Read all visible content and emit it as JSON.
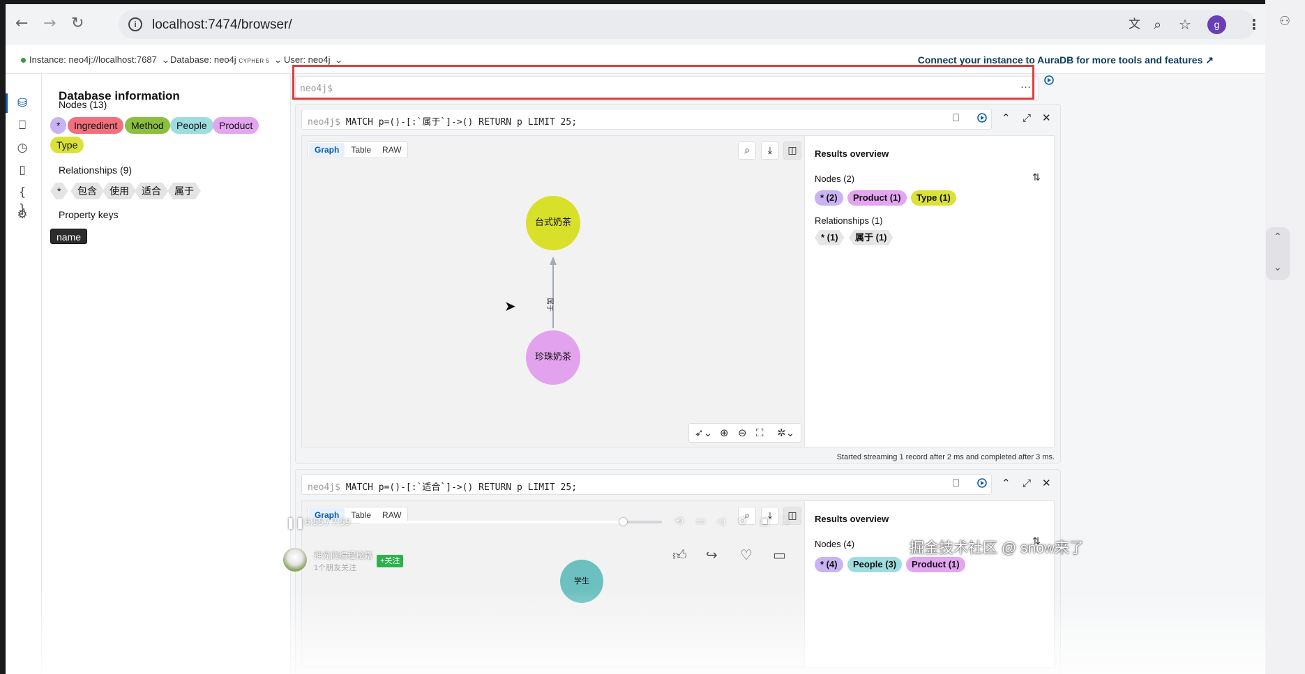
{
  "browser": {
    "url": "localhost:7474/browser/",
    "profile_initial": "g"
  },
  "header": {
    "instance": "Instance: neo4j://localhost:7687",
    "database_prefix": "Database: neo4j",
    "database_badge": "CYPHER 5",
    "user": "User: neo4j",
    "aura_link": "Connect your instance to AuraDB for more tools and features"
  },
  "db_info": {
    "title": "Database information",
    "nodes_title": "Nodes (13)",
    "node_labels": [
      {
        "label": "*",
        "color": "#c9b3f3"
      },
      {
        "label": "Ingredient",
        "color": "#f1707e"
      },
      {
        "label": "Method",
        "color": "#8dbf3e"
      },
      {
        "label": "People",
        "color": "#9ddde0"
      },
      {
        "label": "Product",
        "color": "#e3a5f0"
      },
      {
        "label": "Type",
        "color": "#dae23a"
      }
    ],
    "rels_title": "Relationships (9)",
    "rel_types": [
      "*",
      "包含",
      "使用",
      "适合",
      "属于"
    ],
    "props_title": "Property keys",
    "prop_keys": [
      "name"
    ]
  },
  "editor": {
    "prompt": "neo4j$",
    "more": "···"
  },
  "frames": [
    {
      "prompt": "neo4j$",
      "query": "MATCH p=()-[:`属于`]->() RETURN p LIMIT 25;",
      "tabs": [
        "Graph",
        "Table",
        "RAW"
      ],
      "nodes": [
        {
          "caption": "台式奶茶",
          "color": "#d9e02a"
        },
        {
          "caption": "珍珠奶茶",
          "color": "#e3a2ee"
        }
      ],
      "edge_label": "属于",
      "overview": {
        "title": "Results overview",
        "nodes_title": "Nodes (2)",
        "node_pills": [
          {
            "label": "* (2)",
            "color": "#c9b3f3"
          },
          {
            "label": "Product (1)",
            "color": "#e3a5f0"
          },
          {
            "label": "Type (1)",
            "color": "#dae23a"
          }
        ],
        "rels_title": "Relationships (1)",
        "rel_pills": [
          "* (1)",
          "属于 (1)"
        ]
      },
      "status": "Started streaming 1 record after 2 ms and completed after 3 ms."
    },
    {
      "prompt": "neo4j$",
      "query": "MATCH p=()-[:`适合`]->() RETURN p LIMIT 25;",
      "tabs": [
        "Graph",
        "Table",
        "RAW"
      ],
      "nodes": [
        {
          "caption": "学生",
          "color": "#6cc0c0"
        }
      ],
      "overview": {
        "title": "Results overview",
        "nodes_title": "Nodes (4)",
        "node_pills": [
          {
            "label": "* (4)",
            "color": "#c9b3f3"
          },
          {
            "label": "People (3)",
            "color": "#9ddde0"
          },
          {
            "label": "Product (1)",
            "color": "#e3a5f0"
          }
        ]
      }
    }
  ],
  "video": {
    "time": "6:55 / 7:59",
    "progress": 0.87,
    "author": "神光的编程秘籍",
    "follow": "+关注",
    "subtitle": "1个朋友关注",
    "watermark": "掘金技术社区 @ snow来了"
  }
}
